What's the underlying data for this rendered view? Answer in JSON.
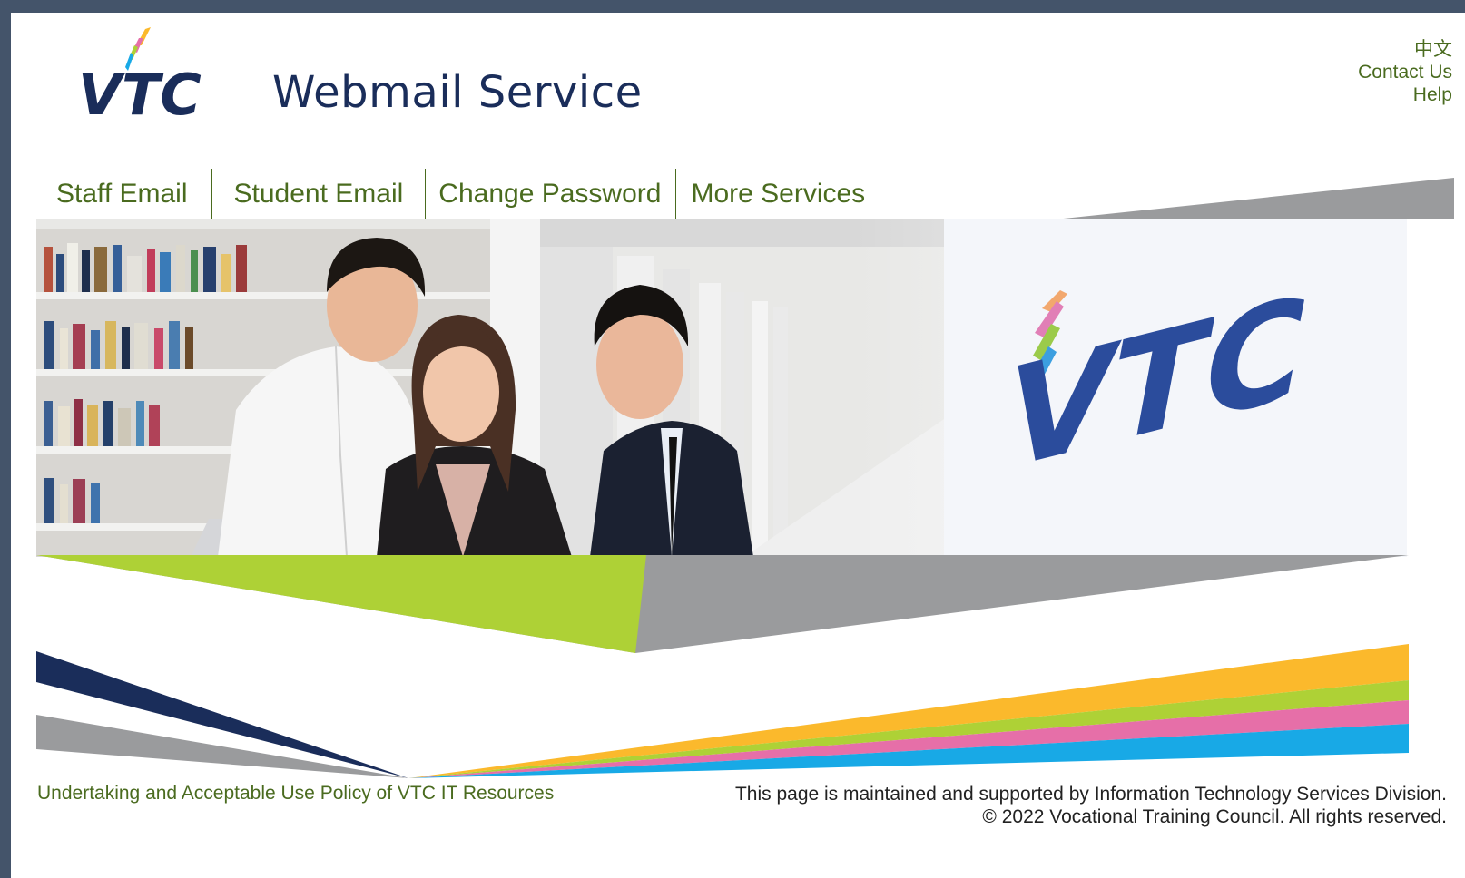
{
  "header": {
    "logo_text": "VTC",
    "service_title": "Webmail Service",
    "top_links": [
      "中文",
      "Contact Us",
      "Help"
    ]
  },
  "nav": {
    "items": [
      "Staff Email",
      "Student Email",
      "Change Password",
      "More Services"
    ]
  },
  "banner": {
    "wall_logo_text": "VTC"
  },
  "footer": {
    "policy_link": "Undertaking and Acceptable Use Policy of VTC IT Resources",
    "maintained_by": "This page is maintained and supported by Information Technology Services Division.",
    "copyright": "© 2022 Vocational Training Council. All rights reserved."
  },
  "colors": {
    "frame_border": "#44546a",
    "link_green": "#4a6b1f",
    "vtc_navy": "#1a2d5a",
    "lime": "#aed136",
    "gray_stripe": "#9a9b9d",
    "orange": "#fbb92c",
    "pink": "#e66fa8",
    "cyan": "#18a9e6"
  }
}
